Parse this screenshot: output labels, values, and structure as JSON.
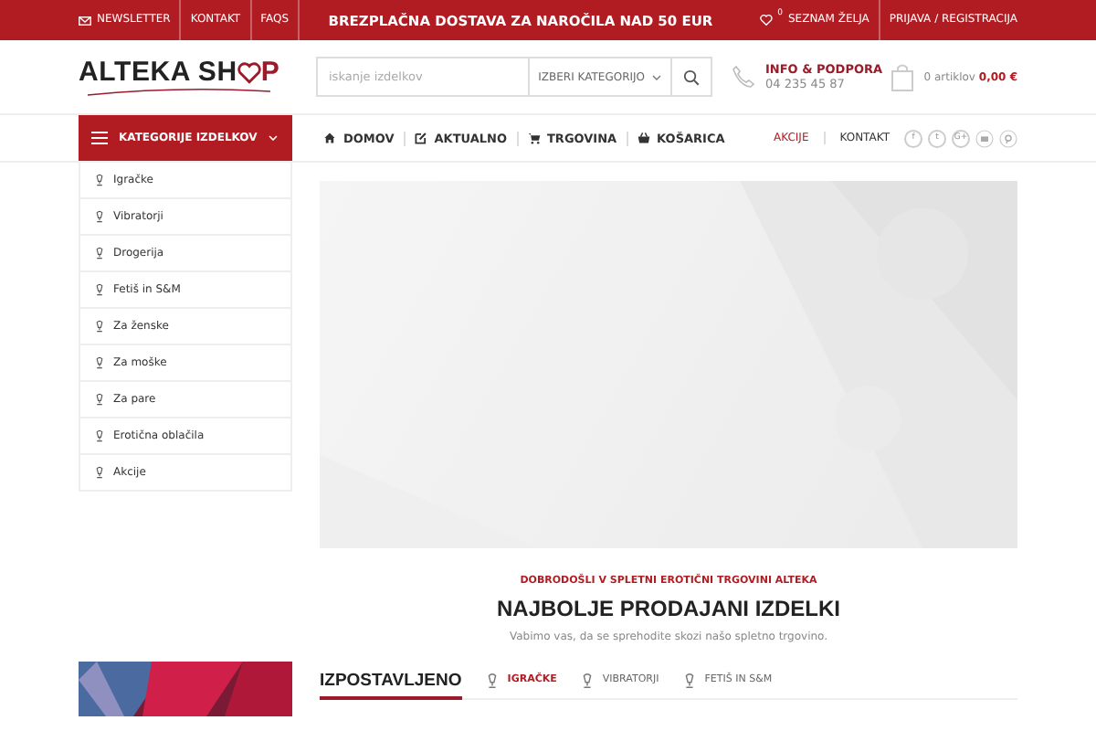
{
  "top_bar": {
    "links": [
      "NEWSLETTER",
      "KONTAKT",
      "FAQS"
    ],
    "promo": "BREZPLAČNA DOSTAVA ZA NAROČILA NAD 50 EUR",
    "wishlist_count": "0",
    "wishlist": "SEZNAM ŽELJA",
    "account": "PRIJAVA / REGISTRACIJA"
  },
  "header": {
    "logo_left": "ALTEKA SH",
    "logo_right": "P",
    "search": {
      "placeholder": "iskanje izdelkov",
      "category": "IZBERI KATEGORIJO"
    },
    "support": {
      "title": "INFO & PODPORA",
      "phone": "04 235 45 87"
    },
    "cart": {
      "count": "0 artiklov",
      "total": "0,00 €"
    }
  },
  "nav": {
    "categories_button": "KATEGORIJE IZDELKOV",
    "items": [
      "DOMOV",
      "AKTUALNO",
      "TRGOVINA",
      "KOŠARICA"
    ],
    "right": [
      {
        "label": "AKCIJE",
        "highlight": true
      },
      {
        "label": "KONTAKT",
        "highlight": false
      }
    ],
    "social": [
      "f",
      "t",
      "G+"
    ]
  },
  "sidebar": {
    "items": [
      "Igračke",
      "Vibratorji",
      "Drogerija",
      "Fetiš in S&M",
      "Za ženske",
      "Za moške",
      "Za pare",
      "Erotična oblačila",
      "Akcije"
    ]
  },
  "intro": {
    "kicker": "DOBRODOŠLI V SPLETNI EROTIČNI TRGOVINI ALTEKA",
    "title": "NAJBOLJE PRODAJANI IZDELKI",
    "text": "Vabimo vas, da se sprehodite skozi našo spletno trgovino."
  },
  "featured": {
    "title": "IZPOSTAVLJENO",
    "tabs": [
      {
        "label": "IGRAČKE",
        "selected": true
      },
      {
        "label": "VIBRATORJI",
        "selected": false
      },
      {
        "label": "FETIŠ IN S&M",
        "selected": false
      }
    ]
  }
}
